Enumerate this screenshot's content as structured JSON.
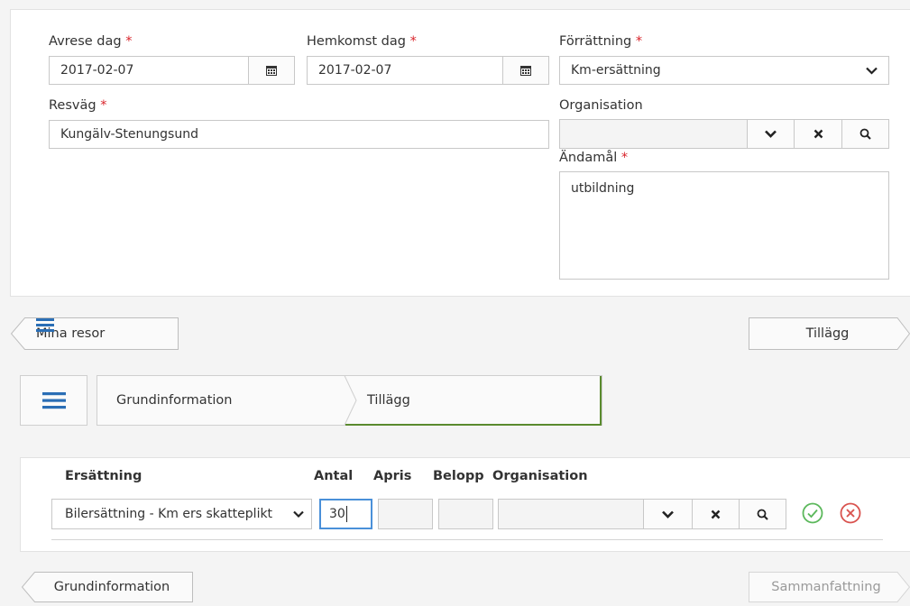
{
  "form": {
    "depart_label": "Avrese dag",
    "depart_value": "2017-02-07",
    "return_label": "Hemkomst dag",
    "return_value": "2017-02-07",
    "errand_label": "Förrättning",
    "errand_value": "Km-ersättning",
    "route_label": "Resväg",
    "route_value": "Kungälv-Stenungsund",
    "org_label": "Organisation",
    "org_value": "",
    "purpose_label": "Ändamål",
    "purpose_value": "utbildning",
    "required_mark": "*"
  },
  "nav1": {
    "back_label": "Mina resor",
    "next_label": "Tillägg"
  },
  "steps": {
    "step1": "Grundinformation",
    "step2": "Tillägg"
  },
  "table": {
    "headers": {
      "compensation": "Ersättning",
      "quantity": "Antal",
      "unit_price": "Apris",
      "amount": "Belopp",
      "organisation": "Organisation"
    },
    "row": {
      "compensation": "Bilersättning - Km ers skatteplikt",
      "quantity": "30",
      "unit_price": "",
      "amount": "",
      "organisation": ""
    }
  },
  "nav2": {
    "back_label": "Grundinformation",
    "next_label": "Sammanfattning"
  },
  "colors": {
    "accent_blue": "#2a6eb5",
    "active_step": "#5a8a2e",
    "confirm_green": "#5cb85c",
    "cancel_red": "#d9534f",
    "required": "#d9242b"
  }
}
